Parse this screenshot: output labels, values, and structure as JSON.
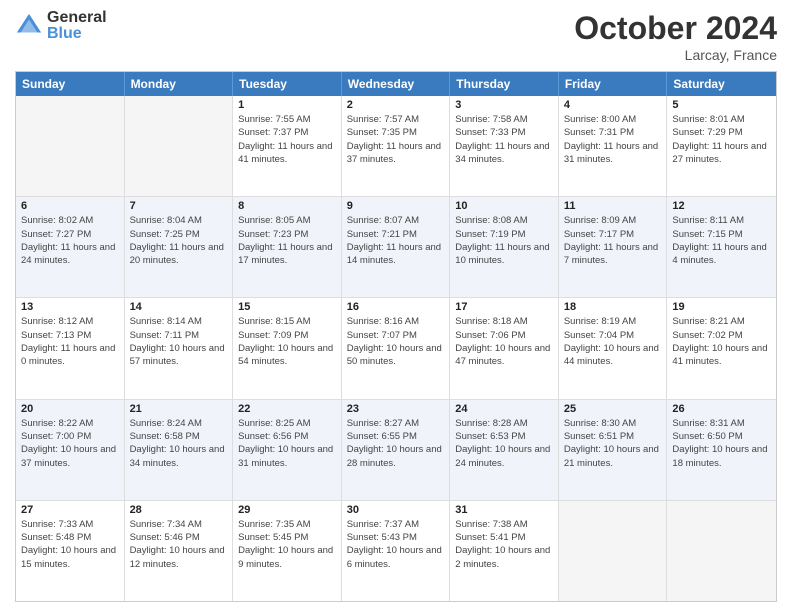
{
  "header": {
    "logo_general": "General",
    "logo_blue": "Blue",
    "month_title": "October 2024",
    "location": "Larcay, France"
  },
  "days_of_week": [
    "Sunday",
    "Monday",
    "Tuesday",
    "Wednesday",
    "Thursday",
    "Friday",
    "Saturday"
  ],
  "weeks": [
    [
      {
        "day": "",
        "sunrise": "",
        "sunset": "",
        "daylight": "",
        "empty": true
      },
      {
        "day": "",
        "sunrise": "",
        "sunset": "",
        "daylight": "",
        "empty": true
      },
      {
        "day": "1",
        "sunrise": "Sunrise: 7:55 AM",
        "sunset": "Sunset: 7:37 PM",
        "daylight": "Daylight: 11 hours and 41 minutes.",
        "empty": false
      },
      {
        "day": "2",
        "sunrise": "Sunrise: 7:57 AM",
        "sunset": "Sunset: 7:35 PM",
        "daylight": "Daylight: 11 hours and 37 minutes.",
        "empty": false
      },
      {
        "day": "3",
        "sunrise": "Sunrise: 7:58 AM",
        "sunset": "Sunset: 7:33 PM",
        "daylight": "Daylight: 11 hours and 34 minutes.",
        "empty": false
      },
      {
        "day": "4",
        "sunrise": "Sunrise: 8:00 AM",
        "sunset": "Sunset: 7:31 PM",
        "daylight": "Daylight: 11 hours and 31 minutes.",
        "empty": false
      },
      {
        "day": "5",
        "sunrise": "Sunrise: 8:01 AM",
        "sunset": "Sunset: 7:29 PM",
        "daylight": "Daylight: 11 hours and 27 minutes.",
        "empty": false
      }
    ],
    [
      {
        "day": "6",
        "sunrise": "Sunrise: 8:02 AM",
        "sunset": "Sunset: 7:27 PM",
        "daylight": "Daylight: 11 hours and 24 minutes.",
        "empty": false
      },
      {
        "day": "7",
        "sunrise": "Sunrise: 8:04 AM",
        "sunset": "Sunset: 7:25 PM",
        "daylight": "Daylight: 11 hours and 20 minutes.",
        "empty": false
      },
      {
        "day": "8",
        "sunrise": "Sunrise: 8:05 AM",
        "sunset": "Sunset: 7:23 PM",
        "daylight": "Daylight: 11 hours and 17 minutes.",
        "empty": false
      },
      {
        "day": "9",
        "sunrise": "Sunrise: 8:07 AM",
        "sunset": "Sunset: 7:21 PM",
        "daylight": "Daylight: 11 hours and 14 minutes.",
        "empty": false
      },
      {
        "day": "10",
        "sunrise": "Sunrise: 8:08 AM",
        "sunset": "Sunset: 7:19 PM",
        "daylight": "Daylight: 11 hours and 10 minutes.",
        "empty": false
      },
      {
        "day": "11",
        "sunrise": "Sunrise: 8:09 AM",
        "sunset": "Sunset: 7:17 PM",
        "daylight": "Daylight: 11 hours and 7 minutes.",
        "empty": false
      },
      {
        "day": "12",
        "sunrise": "Sunrise: 8:11 AM",
        "sunset": "Sunset: 7:15 PM",
        "daylight": "Daylight: 11 hours and 4 minutes.",
        "empty": false
      }
    ],
    [
      {
        "day": "13",
        "sunrise": "Sunrise: 8:12 AM",
        "sunset": "Sunset: 7:13 PM",
        "daylight": "Daylight: 11 hours and 0 minutes.",
        "empty": false
      },
      {
        "day": "14",
        "sunrise": "Sunrise: 8:14 AM",
        "sunset": "Sunset: 7:11 PM",
        "daylight": "Daylight: 10 hours and 57 minutes.",
        "empty": false
      },
      {
        "day": "15",
        "sunrise": "Sunrise: 8:15 AM",
        "sunset": "Sunset: 7:09 PM",
        "daylight": "Daylight: 10 hours and 54 minutes.",
        "empty": false
      },
      {
        "day": "16",
        "sunrise": "Sunrise: 8:16 AM",
        "sunset": "Sunset: 7:07 PM",
        "daylight": "Daylight: 10 hours and 50 minutes.",
        "empty": false
      },
      {
        "day": "17",
        "sunrise": "Sunrise: 8:18 AM",
        "sunset": "Sunset: 7:06 PM",
        "daylight": "Daylight: 10 hours and 47 minutes.",
        "empty": false
      },
      {
        "day": "18",
        "sunrise": "Sunrise: 8:19 AM",
        "sunset": "Sunset: 7:04 PM",
        "daylight": "Daylight: 10 hours and 44 minutes.",
        "empty": false
      },
      {
        "day": "19",
        "sunrise": "Sunrise: 8:21 AM",
        "sunset": "Sunset: 7:02 PM",
        "daylight": "Daylight: 10 hours and 41 minutes.",
        "empty": false
      }
    ],
    [
      {
        "day": "20",
        "sunrise": "Sunrise: 8:22 AM",
        "sunset": "Sunset: 7:00 PM",
        "daylight": "Daylight: 10 hours and 37 minutes.",
        "empty": false
      },
      {
        "day": "21",
        "sunrise": "Sunrise: 8:24 AM",
        "sunset": "Sunset: 6:58 PM",
        "daylight": "Daylight: 10 hours and 34 minutes.",
        "empty": false
      },
      {
        "day": "22",
        "sunrise": "Sunrise: 8:25 AM",
        "sunset": "Sunset: 6:56 PM",
        "daylight": "Daylight: 10 hours and 31 minutes.",
        "empty": false
      },
      {
        "day": "23",
        "sunrise": "Sunrise: 8:27 AM",
        "sunset": "Sunset: 6:55 PM",
        "daylight": "Daylight: 10 hours and 28 minutes.",
        "empty": false
      },
      {
        "day": "24",
        "sunrise": "Sunrise: 8:28 AM",
        "sunset": "Sunset: 6:53 PM",
        "daylight": "Daylight: 10 hours and 24 minutes.",
        "empty": false
      },
      {
        "day": "25",
        "sunrise": "Sunrise: 8:30 AM",
        "sunset": "Sunset: 6:51 PM",
        "daylight": "Daylight: 10 hours and 21 minutes.",
        "empty": false
      },
      {
        "day": "26",
        "sunrise": "Sunrise: 8:31 AM",
        "sunset": "Sunset: 6:50 PM",
        "daylight": "Daylight: 10 hours and 18 minutes.",
        "empty": false
      }
    ],
    [
      {
        "day": "27",
        "sunrise": "Sunrise: 7:33 AM",
        "sunset": "Sunset: 5:48 PM",
        "daylight": "Daylight: 10 hours and 15 minutes.",
        "empty": false
      },
      {
        "day": "28",
        "sunrise": "Sunrise: 7:34 AM",
        "sunset": "Sunset: 5:46 PM",
        "daylight": "Daylight: 10 hours and 12 minutes.",
        "empty": false
      },
      {
        "day": "29",
        "sunrise": "Sunrise: 7:35 AM",
        "sunset": "Sunset: 5:45 PM",
        "daylight": "Daylight: 10 hours and 9 minutes.",
        "empty": false
      },
      {
        "day": "30",
        "sunrise": "Sunrise: 7:37 AM",
        "sunset": "Sunset: 5:43 PM",
        "daylight": "Daylight: 10 hours and 6 minutes.",
        "empty": false
      },
      {
        "day": "31",
        "sunrise": "Sunrise: 7:38 AM",
        "sunset": "Sunset: 5:41 PM",
        "daylight": "Daylight: 10 hours and 2 minutes.",
        "empty": false
      },
      {
        "day": "",
        "sunrise": "",
        "sunset": "",
        "daylight": "",
        "empty": true
      },
      {
        "day": "",
        "sunrise": "",
        "sunset": "",
        "daylight": "",
        "empty": true
      }
    ]
  ]
}
